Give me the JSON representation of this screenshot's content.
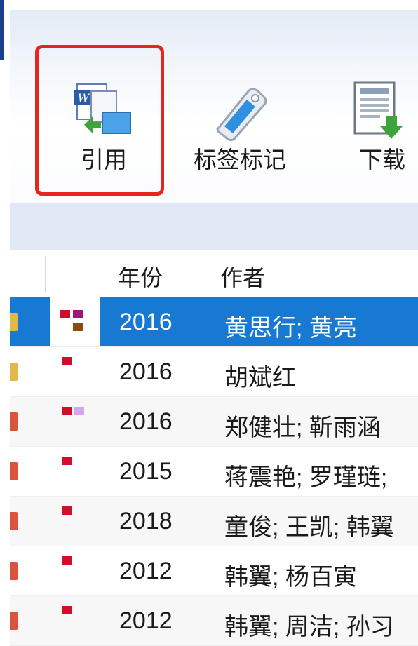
{
  "toolbar": {
    "cite_label": "引用",
    "tag_label": "标签标记",
    "download_label": "下载"
  },
  "table": {
    "headers": {
      "year": "年份",
      "author": "作者"
    },
    "rows": [
      {
        "year": "2016",
        "authors": "黄思行; 黄亮",
        "selected": true
      },
      {
        "year": "2016",
        "authors": "胡斌红",
        "selected": false
      },
      {
        "year": "2016",
        "authors": "郑健壮; 靳雨涵",
        "selected": false
      },
      {
        "year": "2015",
        "authors": "蒋震艳; 罗瑾琏; ",
        "selected": false
      },
      {
        "year": "2018",
        "authors": "童俊; 王凯; 韩翼",
        "selected": false
      },
      {
        "year": "2012",
        "authors": "韩翼; 杨百寅",
        "selected": false
      },
      {
        "year": "2012",
        "authors": "韩翼; 周洁; 孙习",
        "selected": false
      }
    ]
  },
  "colors": {
    "selected_row": "#1879d2",
    "highlight_border": "#e3261f",
    "tag_red": "#d0102a",
    "tag_magenta": "#a0147c",
    "tag_brown": "#8a4a12",
    "tag_lavender": "#d6a4ec"
  }
}
